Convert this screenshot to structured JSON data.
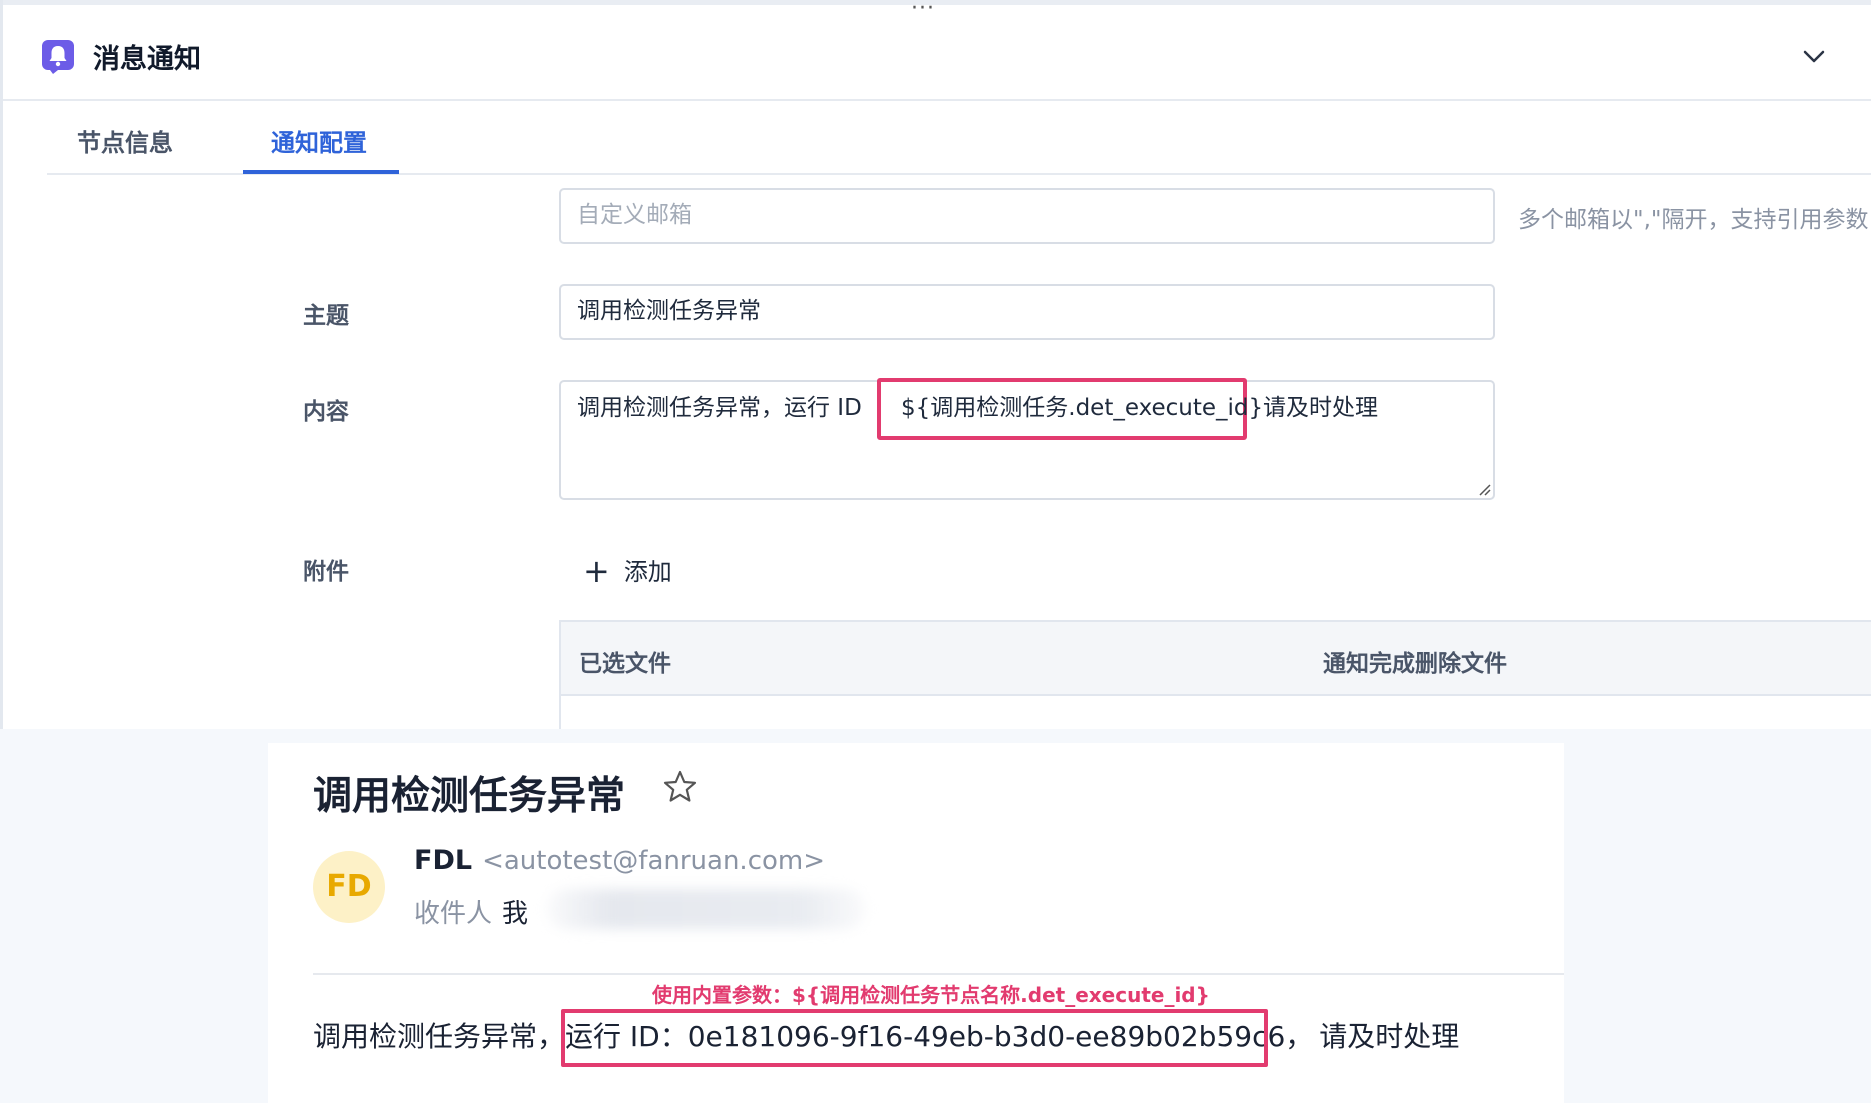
{
  "panel": {
    "title": "消息通知",
    "drag_handle": "···",
    "collapse_icon": "chevron-down-icon",
    "header_icon": "bell-icon",
    "accent_color": "#2f63d9"
  },
  "tabs": [
    {
      "label": "节点信息",
      "active": false
    },
    {
      "label": "通知配置",
      "active": true
    }
  ],
  "form": {
    "email_placeholder": "自定义邮箱",
    "email_hint": "多个邮箱以\",\"隔开，支持引用参数",
    "subject_label": "主题",
    "subject_value": "调用检测任务异常",
    "content_label": "内容",
    "content_prefix": "调用检测任务异常，运行 ID",
    "content_variable": "${调用检测任务.det_execute_id}",
    "content_suffix": "请及时处理",
    "attachment_label": "附件",
    "add_label": "添加",
    "highlight_color": "#e23b6f"
  },
  "file_table": {
    "columns": [
      "已选文件",
      "通知完成删除文件"
    ]
  },
  "email_preview": {
    "subject": "调用检测任务异常",
    "avatar_initials": "FD",
    "sender_name": "FDL",
    "sender_email": "<autotest@fanruan.com>",
    "recipient_label": "收件人",
    "recipient_value": "我",
    "annotation": "使用内置参数：${调用检测任务节点名称.det_execute_id}",
    "body_prefix": "调用检测任务异常，",
    "body_run_id": "运行 ID：0e181096-9f16-49eb-b3d0-ee89b02b59c6，",
    "body_suffix": "请及时处理"
  }
}
